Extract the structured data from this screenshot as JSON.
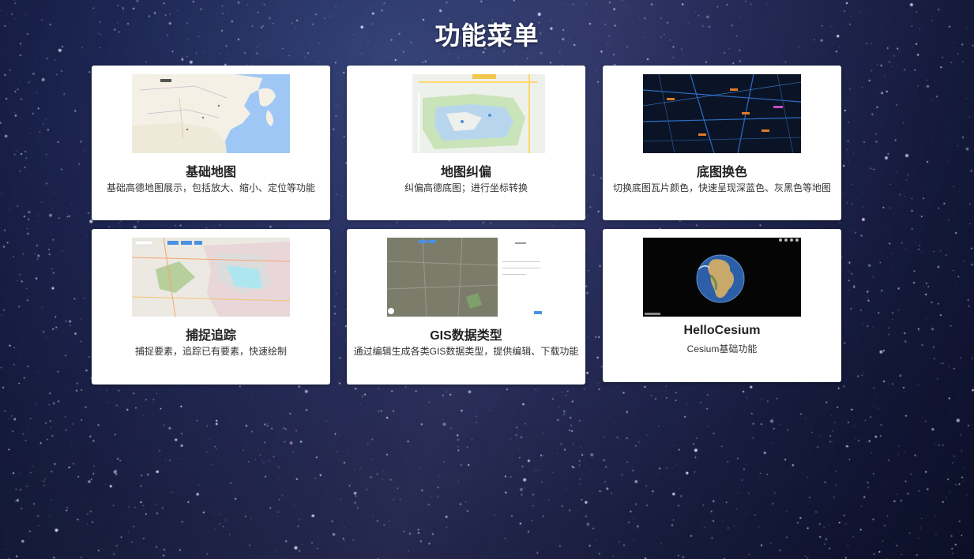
{
  "page": {
    "title": "功能菜单"
  },
  "cards": [
    {
      "title": "基础地图",
      "description": "基础高德地图展示，包括放大、缩小、定位等功能",
      "thumbnail": "china-map-thumbnail"
    },
    {
      "title": "地图纠偏",
      "description": "纠偏高德底图；进行坐标转换",
      "thumbnail": "park-map-thumbnail"
    },
    {
      "title": "底图换色",
      "description": "切换底图瓦片颜色，快速呈现深蓝色、灰黑色等地图",
      "thumbnail": "dark-map-thumbnail"
    },
    {
      "title": "捕捉追踪",
      "description": "捕捉要素，追踪已有要素，快速绘制",
      "thumbnail": "region-map-thumbnail"
    },
    {
      "title": "GIS数据类型",
      "description": "通过编辑生成各类GIS数据类型，提供编辑、下载功能",
      "thumbnail": "satellite-editor-thumbnail"
    },
    {
      "title": "HelloCesium",
      "description": "Cesium基础功能",
      "thumbnail": "globe-thumbnail"
    }
  ]
}
